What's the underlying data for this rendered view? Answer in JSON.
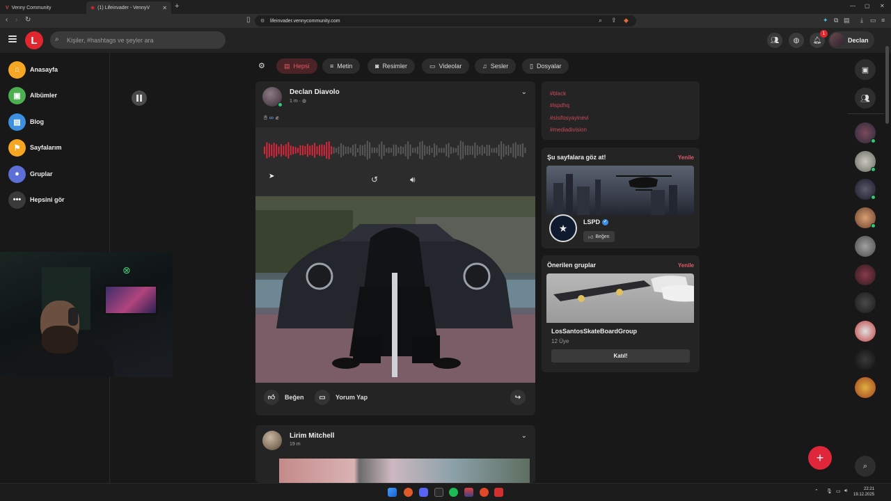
{
  "browser": {
    "tabs": [
      {
        "label": "Venny Community"
      },
      {
        "label": "(1) Lifeinvader - VennyV"
      }
    ],
    "url": "lifeinvader.vennycommunity.com"
  },
  "header": {
    "search_placeholder": "Kişiler, #hashtags ve şeyler ara",
    "notification_count": "1",
    "user_name": "Declan",
    "logo_letter": "L"
  },
  "sidebar": {
    "items": [
      {
        "label": "Anasayfa",
        "color": "#f5a623",
        "icon": "home-icon"
      },
      {
        "label": "Albümler",
        "color": "#4caf50",
        "icon": "album-icon"
      },
      {
        "label": "Blog",
        "color": "#3d8fe0",
        "icon": "blog-icon"
      },
      {
        "label": "Sayfalarım",
        "color": "#f5a623",
        "icon": "flag-icon"
      },
      {
        "label": "Gruplar",
        "color": "#5b6fd6",
        "icon": "group-icon"
      },
      {
        "label": "Hepsini gör",
        "color": "#3a3a3a",
        "icon": "more-icon"
      }
    ]
  },
  "filters": {
    "items": [
      {
        "label": "Hepsi",
        "active": true
      },
      {
        "label": "Metin"
      },
      {
        "label": "Resimler"
      },
      {
        "label": "Videolar"
      },
      {
        "label": "Sesler"
      },
      {
        "label": "Dosyalar"
      }
    ]
  },
  "posts": [
    {
      "author": "Declan Diavolo",
      "time": "1 m",
      "audio_progress": 0.26,
      "actions": {
        "like": "Beğen",
        "comment": "Yorum Yap"
      }
    },
    {
      "author": "Lirim Mitchell",
      "time": "19 m"
    }
  ],
  "right": {
    "tags": [
      "#black",
      "#lspdhq",
      "#sisifosyayinevi",
      "#mediadivision"
    ],
    "pages_widget": {
      "title": "Şu sayfalara göz at!",
      "refresh": "Yenile",
      "page_name": "LSPD",
      "like_label": "Beğen"
    },
    "groups_widget": {
      "title": "Önerilen gruplar",
      "refresh": "Yenile",
      "group_name": "LosSantosSkateBoardGroup",
      "member_count": "12 Üye",
      "join_label": "Katıl!"
    }
  },
  "taskbar": {
    "time": "22:21",
    "date": "19.12.2025"
  },
  "colors": {
    "accent": "#e0262f",
    "active_filter_bg": "#4a2326",
    "active_filter_text": "#e05a6a",
    "tag": "#c84a5a"
  }
}
